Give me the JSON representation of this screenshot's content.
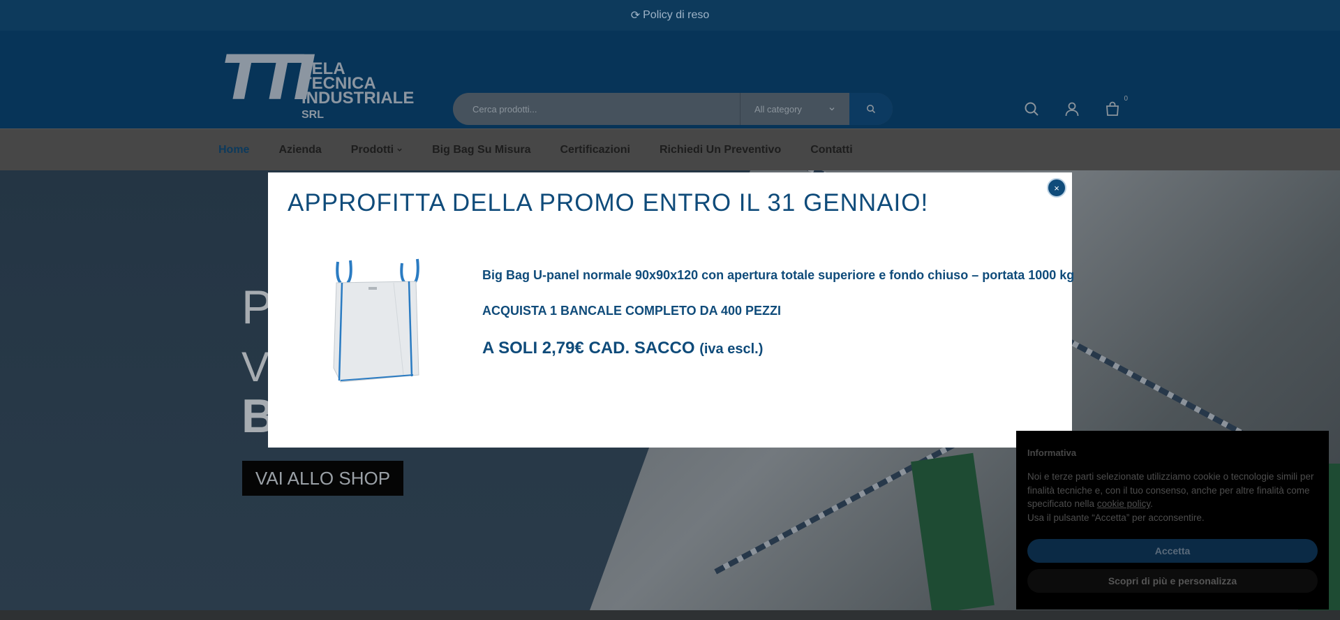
{
  "topbar": {
    "text": "Policy di reso",
    "icon": "refresh-icon"
  },
  "header": {
    "logo": {
      "mark": "TTI",
      "line1": "TELA",
      "line2": "TECNICA",
      "line3": "INDUSTRIALE",
      "suffix": "SRL"
    },
    "search": {
      "placeholder": "Cerca prodotti...",
      "category": "All category"
    },
    "icons": [
      "search-icon",
      "user-icon",
      "cart-icon"
    ],
    "cart_count": "0"
  },
  "nav": {
    "items": [
      {
        "label": "Home",
        "active": true
      },
      {
        "label": "Azienda"
      },
      {
        "label": "Prodotti",
        "has_dropdown": true
      },
      {
        "label": "Big Bag Su Misura"
      },
      {
        "label": "Certificazioni"
      },
      {
        "label": "Richiedi Un Preventivo"
      },
      {
        "label": "Contatti"
      }
    ]
  },
  "hero": {
    "line1": "P",
    "line2": "V",
    "line3": "B",
    "button": "VAI ALLO SHOP"
  },
  "modal": {
    "title": "APPROFITTA DELLA PROMO ENTRO IL 31 GENNAIO!",
    "product": "Big Bag U-panel normale 90x90x120 con apertura totale superiore e fondo chiuso – portata 1000 kg",
    "offer": "ACQUISTA 1 BANCALE COMPLETO DA 400 PEZZI",
    "price": "A SOLI 2,79€ CAD. SACCO",
    "price_note": "(iva escl.)",
    "close": "×"
  },
  "cookie": {
    "title": "Informativa",
    "text_before": "Noi e terze parti selezionate utilizziamo cookie o tecnologie simili per finalità tecniche e, con il tuo consenso, anche per altre finalità come specificato nella ",
    "link": "cookie policy",
    "text_after": ".",
    "text2": "Usa il pulsante “Accetta” per acconsentire.",
    "accept": "Accetta",
    "more": "Scopri di più e personalizza"
  }
}
